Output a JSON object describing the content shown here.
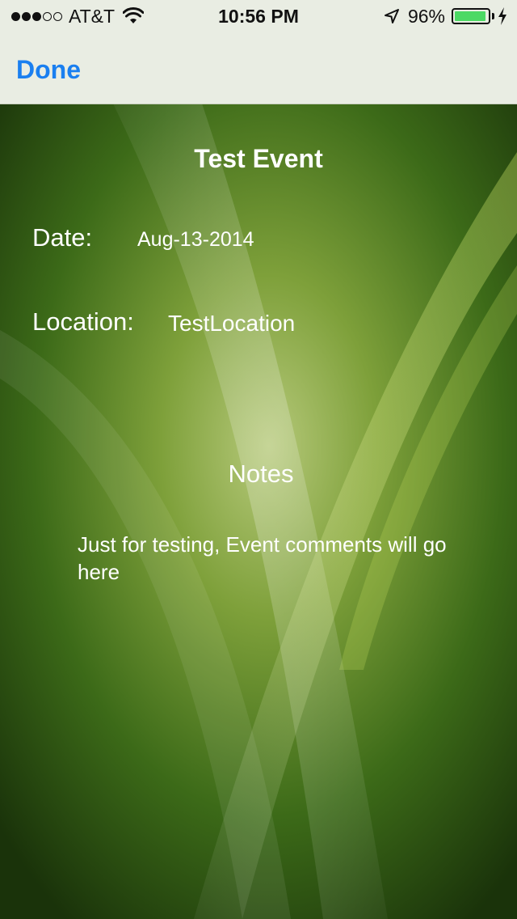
{
  "status_bar": {
    "carrier": "AT&T",
    "time": "10:56 PM",
    "battery_percent_label": "96%",
    "battery_level": 0.96,
    "signal_bars_filled": 3,
    "signal_bars_total": 5,
    "icons": [
      "wifi-icon",
      "location-arrow-icon",
      "battery-icon",
      "charging-bolt-icon"
    ]
  },
  "nav": {
    "done_label": "Done"
  },
  "event": {
    "title": "Test Event",
    "date_label": "Date:",
    "date_value": "Aug-13-2014",
    "location_label": "Location:",
    "location_value": "TestLocation",
    "notes_heading": "Notes",
    "notes_text": "Just for testing, Event comments will go here"
  },
  "colors": {
    "accent": "#1a7ff0",
    "nav_background": "#e9ede3",
    "background_dark": "#1f3a0c",
    "background_light": "#8fb04a",
    "battery_fill": "#4cd964",
    "text": "#ffffff"
  }
}
